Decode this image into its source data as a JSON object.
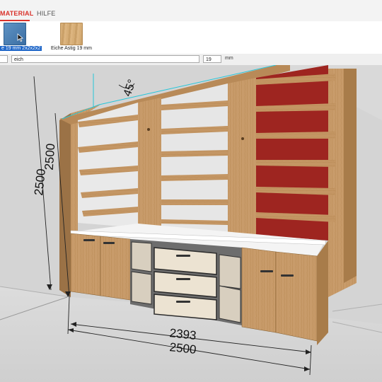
{
  "menu": {
    "material": "MATERIAL",
    "hilfe": "HILFE"
  },
  "materials": {
    "selected_label": "e 19 mm 2x2x2x2",
    "oak_label": "Eiche Astig 19 mm"
  },
  "fields": {
    "name": "eich",
    "thickness": "19",
    "unit": "mm"
  },
  "dimensions": {
    "angle": "45°",
    "height_outer": "2500",
    "height_inner": "2500",
    "width_inner": "2393",
    "width_outer": "2500"
  },
  "colors": {
    "accent": "#d9322b",
    "selection": "#1e66c8",
    "back_panel": "#9e2520",
    "wood": "#c89b6a"
  }
}
